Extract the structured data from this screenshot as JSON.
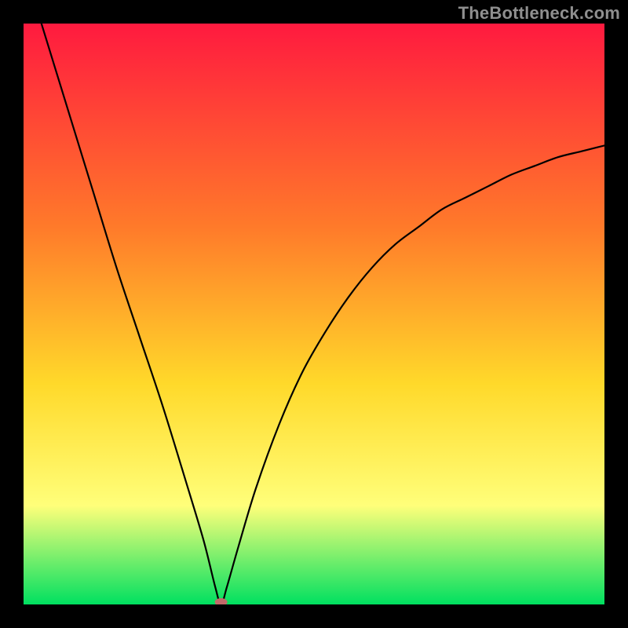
{
  "watermark": "TheBottleneck.com",
  "colors": {
    "gradient_top": "#ff1a3f",
    "gradient_mid1": "#ff7a2a",
    "gradient_mid2": "#ffd92a",
    "gradient_mid3": "#ffff7a",
    "gradient_bottom": "#00e060",
    "curve": "#000000",
    "marker": "#c26a6a",
    "frame": "#000000"
  },
  "chart_data": {
    "type": "line",
    "title": "",
    "xlabel": "",
    "ylabel": "",
    "xlim": [
      0,
      100
    ],
    "ylim": [
      0,
      100
    ],
    "minimum": {
      "x": 34,
      "y": 0
    },
    "curve": {
      "x": [
        0,
        4,
        8,
        12,
        16,
        20,
        24,
        28,
        31,
        33,
        34,
        35,
        37,
        40,
        44,
        48,
        52,
        56,
        60,
        64,
        68,
        72,
        76,
        80,
        84,
        88,
        92,
        96,
        100
      ],
      "y": [
        110,
        97,
        84,
        71,
        58,
        46,
        34,
        21,
        11,
        3,
        0,
        3,
        10,
        20,
        31,
        40,
        47,
        53,
        58,
        62,
        65,
        68,
        70,
        72,
        74,
        75.5,
        77,
        78,
        79
      ]
    },
    "marker": {
      "x": 34,
      "y": 0
    },
    "grid": false,
    "legend": false
  }
}
